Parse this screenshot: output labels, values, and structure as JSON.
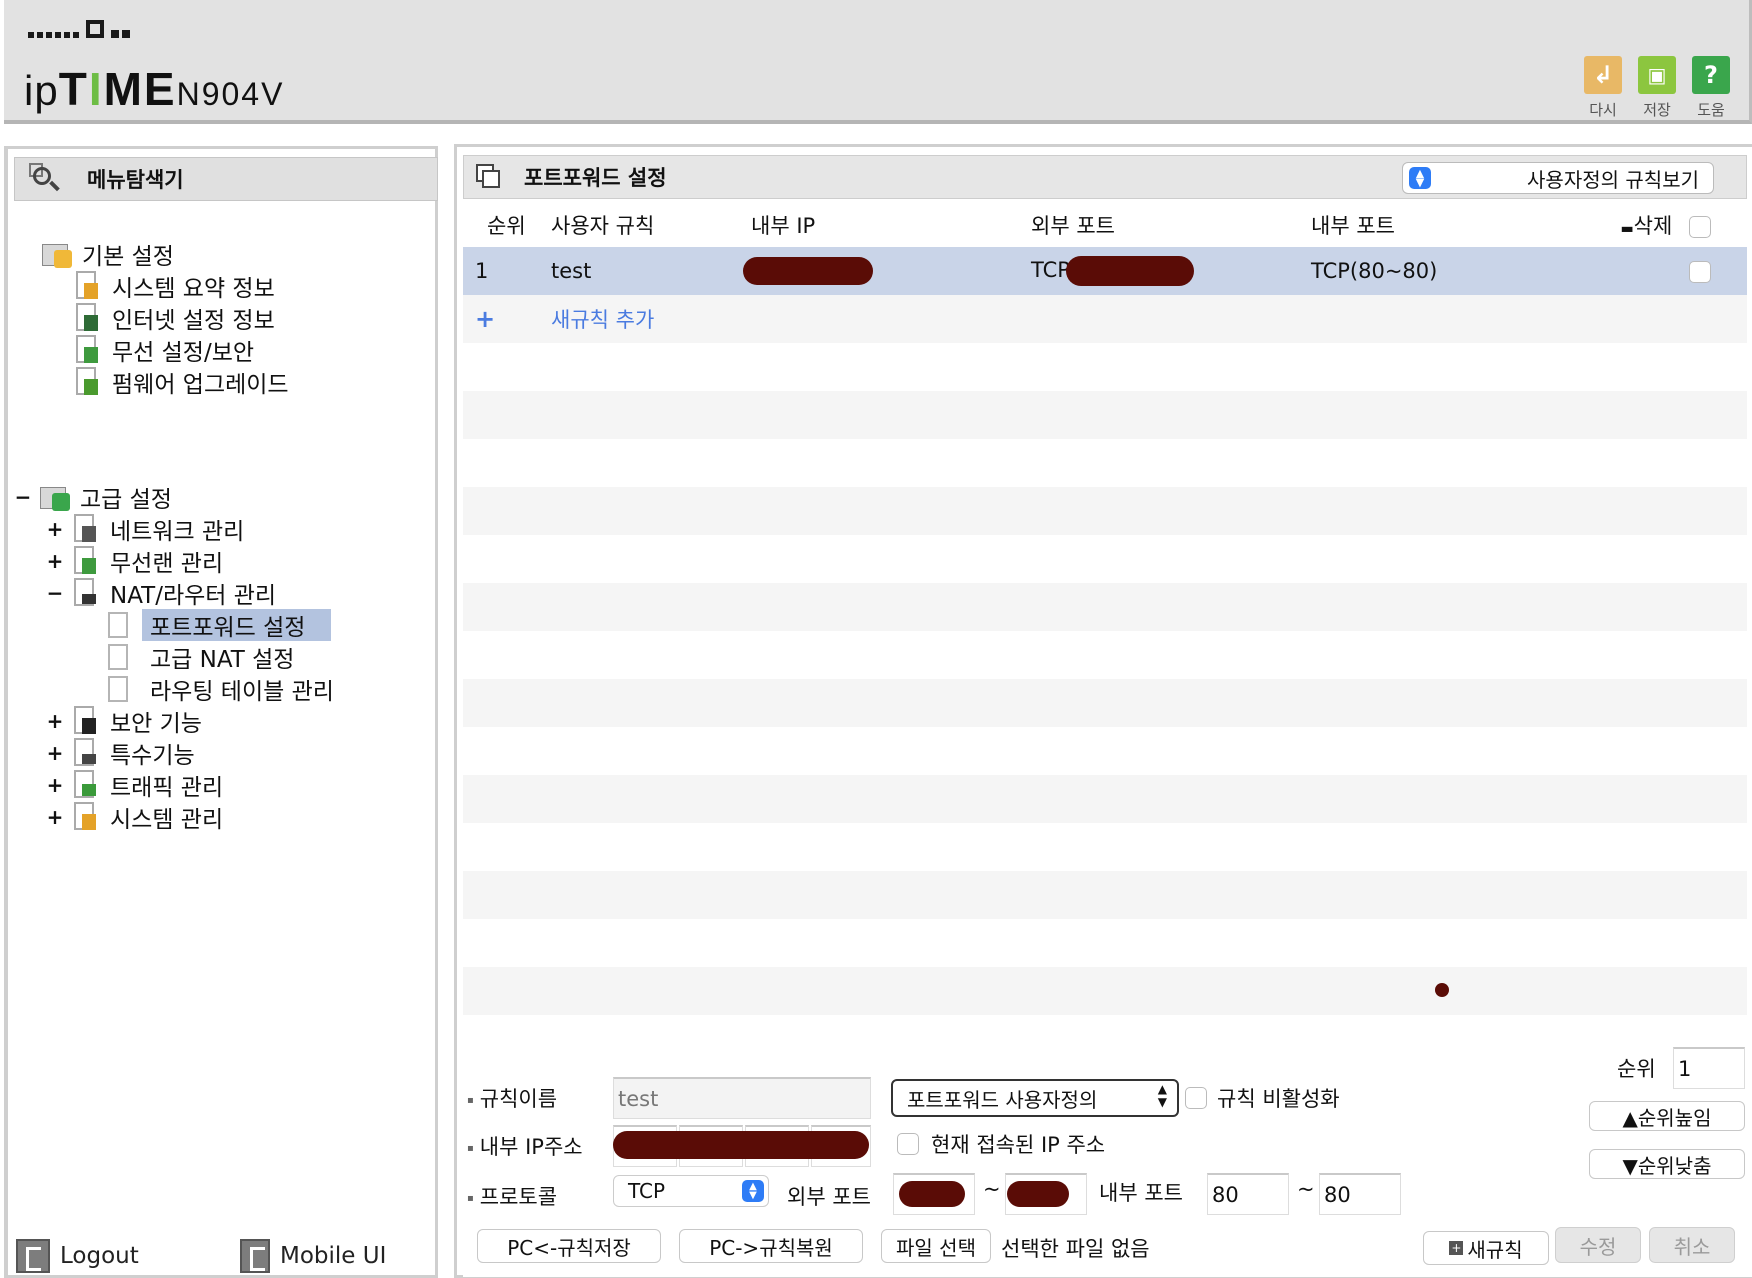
{
  "header": {
    "brand_ip": "ip",
    "brand_t": "T",
    "brand_i": "I",
    "brand_me": "ME",
    "model": "N904V",
    "actions": [
      {
        "label": "다시",
        "icon": "undo-icon",
        "color": "#e8b866"
      },
      {
        "label": "저장",
        "icon": "save-icon",
        "color": "#8cc63f"
      },
      {
        "label": "도움",
        "icon": "help-icon",
        "color": "#3aa64c"
      }
    ]
  },
  "sidebar": {
    "title": "메뉴탐색기",
    "basic": {
      "label": "기본 설정",
      "items": [
        "시스템 요약 정보",
        "인터넷 설정 정보",
        "무선 설정/보안",
        "펌웨어 업그레이드"
      ]
    },
    "advanced": {
      "label": "고급 설정",
      "expand": "−",
      "items": [
        {
          "label": "네트워크 관리",
          "expand": "+"
        },
        {
          "label": "무선랜 관리",
          "expand": "+"
        },
        {
          "label": "NAT/라우터 관리",
          "expand": "−"
        },
        {
          "label": "보안 기능",
          "expand": "+"
        },
        {
          "label": "특수기능",
          "expand": "+"
        },
        {
          "label": "트래픽 관리",
          "expand": "+"
        },
        {
          "label": "시스템 관리",
          "expand": "+"
        }
      ],
      "nat_children": [
        "포트포워드 설정",
        "고급 NAT 설정",
        "라우팅 테이블 관리"
      ]
    },
    "footer": {
      "logout": "Logout",
      "mobile": "Mobile UI"
    }
  },
  "main": {
    "title": "포트포워드 설정",
    "view_select": "사용자정의 규칙보기",
    "columns": [
      "순위",
      "사용자 규칙",
      "내부 IP",
      "외부 포트",
      "내부 포트",
      "삭제"
    ],
    "rows": [
      {
        "rank": "1",
        "name": "test",
        "internal_ip": "",
        "external_port": "TCP",
        "internal_port": "TCP(80~80)"
      }
    ],
    "add_rule": "새규칙 추가",
    "add_plus": "+"
  },
  "form": {
    "rule_name_label": "규칙이름",
    "rule_name_value": "test",
    "rule_type": "포트포워드 사용자정의",
    "disable_rule_label": "규칙 비활성화",
    "internal_ip_label": "내부 IP주소",
    "current_ip_label": "현재 접속된 IP 주소",
    "protocol_label": "프로토콜",
    "protocol_value": "TCP",
    "external_port_label": "외부 포트",
    "internal_port_label": "내부 포트",
    "tilde": "~",
    "internal_port_from": "80",
    "internal_port_to": "80",
    "rank_label": "순위",
    "rank_value": "1",
    "rank_up": "▲순위높임",
    "rank_down": "▼순위낮춤",
    "save_pc": "PC<-규칙저장",
    "restore_pc": "PC->규칙복원",
    "file_select": "파일 선택",
    "no_file": "선택한 파일 없음",
    "new_rule": "새규칙",
    "modify": "수정",
    "cancel": "취소"
  }
}
